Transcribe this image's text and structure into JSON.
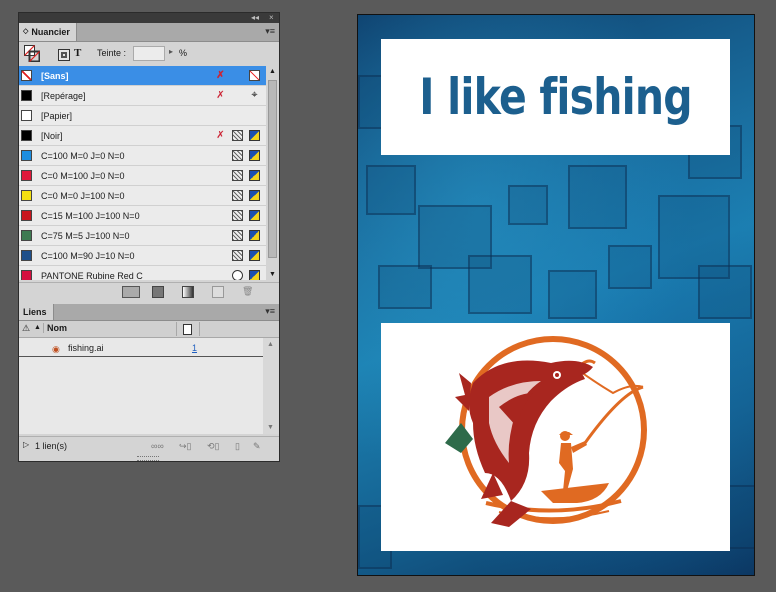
{
  "swatches_panel": {
    "tab_label": "Nuancier",
    "tint_label": "Teinte :",
    "tint_value": "",
    "tint_unit": "%",
    "items": [
      {
        "name": "[Sans]",
        "color": "#ffffff",
        "kind": "none",
        "selected": true
      },
      {
        "name": "[Repérage]",
        "color": "#000000",
        "kind": "registration"
      },
      {
        "name": "[Papier]",
        "color": "#ffffff",
        "kind": "paper"
      },
      {
        "name": "[Noir]",
        "color": "#000000",
        "kind": "process-locked"
      },
      {
        "name": "C=100 M=0 J=0 N=0",
        "color": "#1e8ee0",
        "kind": "process"
      },
      {
        "name": "C=0 M=100 J=0 N=0",
        "color": "#e0193a",
        "kind": "process"
      },
      {
        "name": "C=0 M=0 J=100 N=0",
        "color": "#f3e012",
        "kind": "process"
      },
      {
        "name": "C=15 M=100 J=100 N=0",
        "color": "#c8161d",
        "kind": "process"
      },
      {
        "name": "C=75 M=5 J=100 N=0",
        "color": "#3e7a52",
        "kind": "process"
      },
      {
        "name": "C=100 M=90 J=10 N=0",
        "color": "#1f4f8a",
        "kind": "process"
      },
      {
        "name": "PANTONE Rubine Red C",
        "color": "#d4103f",
        "kind": "spot"
      }
    ]
  },
  "links_panel": {
    "tab_label": "Liens",
    "column_name": "Nom",
    "links": [
      {
        "name": "fishing.ai",
        "page": "1"
      }
    ],
    "status": "1 lien(s)"
  },
  "document": {
    "headline": "I like fishing",
    "headline_color": "#1c5f8e",
    "artwork_colors": {
      "orange": "#e06a22",
      "red": "#a8261f",
      "green": "#2e6b4a"
    }
  }
}
